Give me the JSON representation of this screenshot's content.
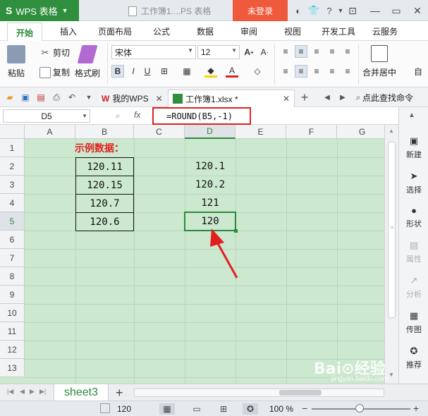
{
  "titlebar": {
    "app_name": "WPS 表格",
    "doc_title": "工作簿1....PS 表格",
    "login": "未登录"
  },
  "ribbon_tabs": [
    "开始",
    "插入",
    "页面布局",
    "公式",
    "数据",
    "审阅",
    "视图",
    "开发工具",
    "云服务"
  ],
  "ribbon": {
    "paste": "粘贴",
    "cut": "剪切",
    "copy": "复制",
    "format_painter": "格式刷",
    "font_name": "宋体",
    "font_size": "12",
    "bold": "B",
    "italic": "I",
    "underline": "U",
    "merge_center": "合并居中"
  },
  "quickbar": {
    "tab_mywps": "我的WPS",
    "tab_workbook": "工作簿1.xlsx *",
    "search": "点此查找命令"
  },
  "formula_bar": {
    "name_box": "D5",
    "fx": "fx",
    "formula": "=ROUND(B5,-1)"
  },
  "grid": {
    "columns": [
      "A",
      "B",
      "C",
      "D",
      "E",
      "F",
      "G"
    ],
    "rows": [
      "1",
      "2",
      "3",
      "4",
      "5",
      "6",
      "7",
      "8",
      "9",
      "10",
      "11",
      "12",
      "13"
    ],
    "label": "示例数据：",
    "b_values": [
      "120.11",
      "120.15",
      "120.7",
      "120.6"
    ],
    "d_values": [
      "120.1",
      "120.2",
      "121",
      "120"
    ]
  },
  "right_panel": [
    "新建",
    "选择",
    "形状",
    "属性",
    "分析",
    "传图",
    "推荐"
  ],
  "sheetbar": {
    "sheet_name": "sheet3",
    "add": "+"
  },
  "statusbar": {
    "value": "120",
    "zoom": "100 %"
  },
  "watermark": {
    "text": "Bai⊙经验",
    "sub": "jingyan.baidu.com"
  },
  "colors": {
    "brand_green": "#2f8f3e",
    "login_red": "#f05a3c",
    "grid_bg": "#cce8cf",
    "highlight_red": "#e02020"
  }
}
